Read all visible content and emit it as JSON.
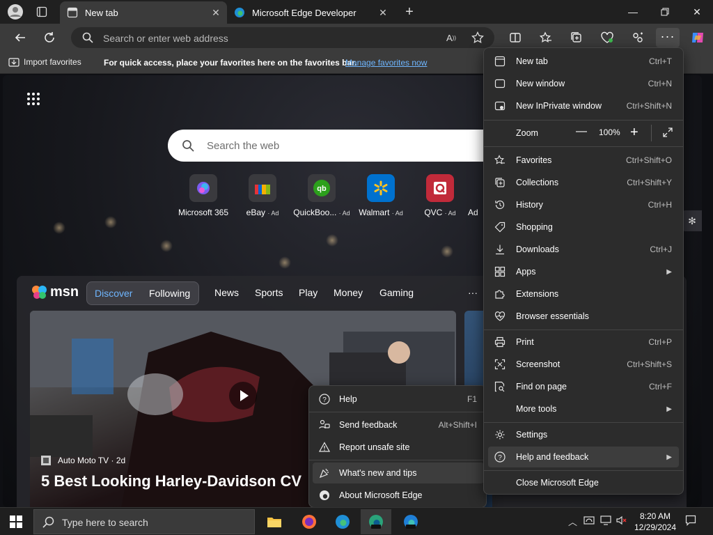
{
  "tabs": [
    {
      "title": "New tab",
      "active": true
    },
    {
      "title": "Microsoft Edge Developer",
      "active": false
    }
  ],
  "address": {
    "placeholder": "Search or enter web address"
  },
  "favorites_bar": {
    "import_label": "Import favorites",
    "hint": "For quick access, place your favorites here on the favorites bar.",
    "manage_link": "Manage favorites now"
  },
  "newtab": {
    "search_placeholder": "Search the web",
    "tiles": [
      {
        "label": "Microsoft 365",
        "ad": ""
      },
      {
        "label": "eBay",
        "ad": "· Ad"
      },
      {
        "label": "QuickBoo...",
        "ad": "· Ad"
      },
      {
        "label": "Walmart",
        "ad": "· Ad"
      },
      {
        "label": "QVC",
        "ad": "· Ad"
      },
      {
        "label": "Ad",
        "ad": ""
      }
    ]
  },
  "feed": {
    "logo": "msn",
    "pill": [
      "Discover",
      "Following"
    ],
    "nav": [
      "News",
      "Sports",
      "Play",
      "Money",
      "Gaming"
    ],
    "more": "···",
    "hero_source": "Auto Moto TV · 2d",
    "hero_headline": "5 Best Looking Harley-Davidson CV"
  },
  "menu": {
    "items": [
      {
        "label": "New tab",
        "shortcut": "Ctrl+T",
        "icon": "new-tab-icon"
      },
      {
        "label": "New window",
        "shortcut": "Ctrl+N",
        "icon": "window-icon"
      },
      {
        "label": "New InPrivate window",
        "shortcut": "Ctrl+Shift+N",
        "icon": "inprivate-icon"
      },
      {
        "label": "Favorites",
        "shortcut": "Ctrl+Shift+O",
        "icon": "star-icon"
      },
      {
        "label": "Collections",
        "shortcut": "Ctrl+Shift+Y",
        "icon": "collections-icon"
      },
      {
        "label": "History",
        "shortcut": "Ctrl+H",
        "icon": "history-icon"
      },
      {
        "label": "Shopping",
        "shortcut": "",
        "icon": "tag-icon"
      },
      {
        "label": "Downloads",
        "shortcut": "Ctrl+J",
        "icon": "download-icon"
      },
      {
        "label": "Apps",
        "shortcut": "",
        "icon": "apps-icon"
      },
      {
        "label": "Extensions",
        "shortcut": "",
        "icon": "puzzle-icon"
      },
      {
        "label": "Browser essentials",
        "shortcut": "",
        "icon": "heart-pulse-icon"
      },
      {
        "label": "Print",
        "shortcut": "Ctrl+P",
        "icon": "printer-icon"
      },
      {
        "label": "Screenshot",
        "shortcut": "Ctrl+Shift+S",
        "icon": "screenshot-icon"
      },
      {
        "label": "Find on page",
        "shortcut": "Ctrl+F",
        "icon": "find-icon"
      },
      {
        "label": "More tools",
        "shortcut": "",
        "icon": "more-tools-icon"
      },
      {
        "label": "Settings",
        "shortcut": "",
        "icon": "gear-icon"
      },
      {
        "label": "Help and feedback",
        "shortcut": "",
        "icon": "help-icon"
      },
      {
        "label": "Close Microsoft Edge",
        "shortcut": "",
        "icon": ""
      }
    ],
    "zoom": {
      "label": "Zoom",
      "minus": "—",
      "value": "100%",
      "plus": "+"
    }
  },
  "submenu": {
    "items": [
      {
        "label": "Help",
        "shortcut": "F1"
      },
      {
        "label": "Send feedback",
        "shortcut": "Alt+Shift+I"
      },
      {
        "label": "Report unsafe site",
        "shortcut": ""
      },
      {
        "label": "What's new and tips",
        "shortcut": ""
      },
      {
        "label": "About Microsoft Edge",
        "shortcut": ""
      }
    ]
  },
  "taskbar": {
    "search_placeholder": "Type here to search",
    "time": "8:20 AM",
    "date": "12/29/2024"
  },
  "colors": {
    "accent": "#6fb6ff",
    "menu_bg": "#2c2c2c",
    "pill_active": "#6fb6ff"
  }
}
